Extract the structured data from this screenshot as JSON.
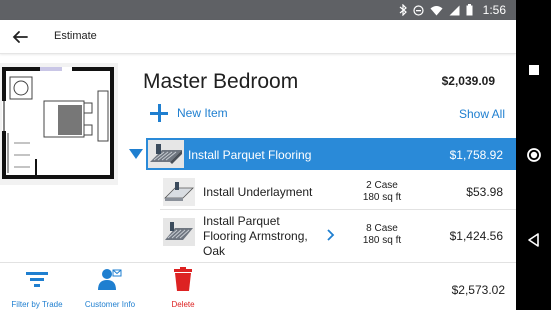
{
  "status_bar": {
    "time": "1:56",
    "icons": [
      "bluetooth-icon",
      "minus-circle-icon",
      "wifi-icon",
      "signal-icon",
      "battery-icon"
    ]
  },
  "app_bar": {
    "back_icon": "back-arrow-icon",
    "title": "Estimate"
  },
  "room": {
    "title": "Master Bedroom",
    "total": "$2,039.09"
  },
  "actions": {
    "new_item": "New Item",
    "show_all": "Show All"
  },
  "selected_item": {
    "name": "Install Parquet Flooring",
    "price": "$1,758.92"
  },
  "sub_items": [
    {
      "name_lines": [
        "Install Underlayment"
      ],
      "qty": "2 Case",
      "area": "180 sq ft",
      "price": "$53.98"
    },
    {
      "name_lines": [
        "Install Parquet",
        "Flooring Armstrong,",
        "Oak"
      ],
      "qty": "8 Case",
      "area": "180 sq ft",
      "price": "$1,424.56"
    }
  ],
  "bottom_tabs": [
    {
      "label": "Filter by Trade",
      "icon": "filter-icon"
    },
    {
      "label": "Customer Info",
      "icon": "customer-info-icon"
    },
    {
      "label": "Delete",
      "icon": "trash-icon"
    }
  ],
  "grand_total": "$2,573.02",
  "colors": {
    "accent": "#1f7fd0",
    "selected_row": "#2a8ad8",
    "delete": "#dd2222",
    "status_bar": "#5f6165"
  }
}
